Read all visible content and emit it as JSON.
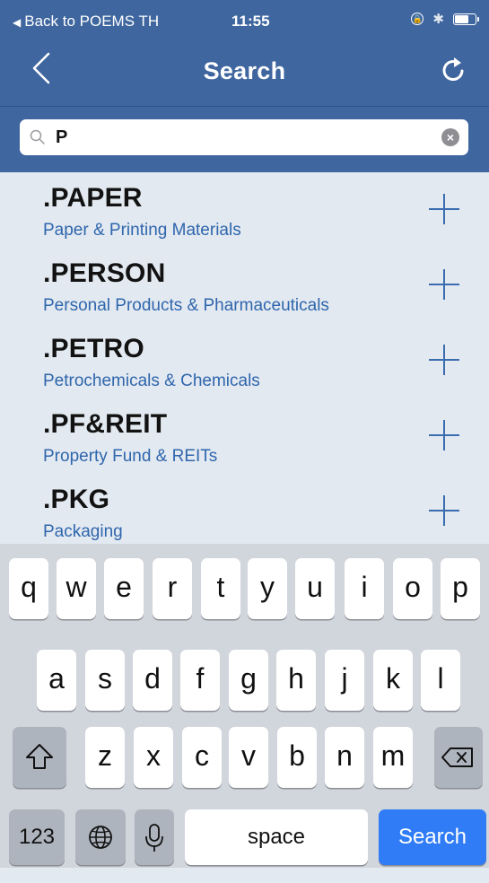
{
  "status_bar": {
    "back_label": "Back to POEMS TH",
    "time": "11:55",
    "battery_level": 0.7
  },
  "nav": {
    "title": "Search"
  },
  "search": {
    "value": "P",
    "placeholder": ""
  },
  "results": [
    {
      "code": ".PAPER",
      "name": "Paper & Printing Materials"
    },
    {
      "code": ".PERSON",
      "name": "Personal Products & Pharmaceuticals"
    },
    {
      "code": ".PETRO",
      "name": "Petrochemicals & Chemicals"
    },
    {
      "code": ".PF&REIT",
      "name": "Property Fund & REITs"
    },
    {
      "code": ".PKG",
      "name": "Packaging"
    }
  ],
  "keyboard": {
    "row1": [
      "q",
      "w",
      "e",
      "r",
      "t",
      "y",
      "u",
      "i",
      "o",
      "p"
    ],
    "row2": [
      "a",
      "s",
      "d",
      "f",
      "g",
      "h",
      "j",
      "k",
      "l"
    ],
    "row3": [
      "z",
      "x",
      "c",
      "v",
      "b",
      "n",
      "m"
    ],
    "numbers_label": "123",
    "space_label": "space",
    "return_label": "Search"
  },
  "colors": {
    "nav_background": "#3f669f",
    "list_background": "#e3e9f0",
    "subtitle_text": "#2f66ad",
    "keyboard_background": "#d1d5dc",
    "search_key": "#2f7cf6"
  },
  "icons": {
    "back": "chevron-left-icon",
    "refresh": "refresh-icon",
    "search": "magnifier-icon",
    "clear": "clear-circle-icon",
    "add": "plus-icon",
    "shift": "shift-arrow-icon",
    "delete": "backspace-icon",
    "globe": "globe-icon",
    "mic": "microphone-icon"
  }
}
